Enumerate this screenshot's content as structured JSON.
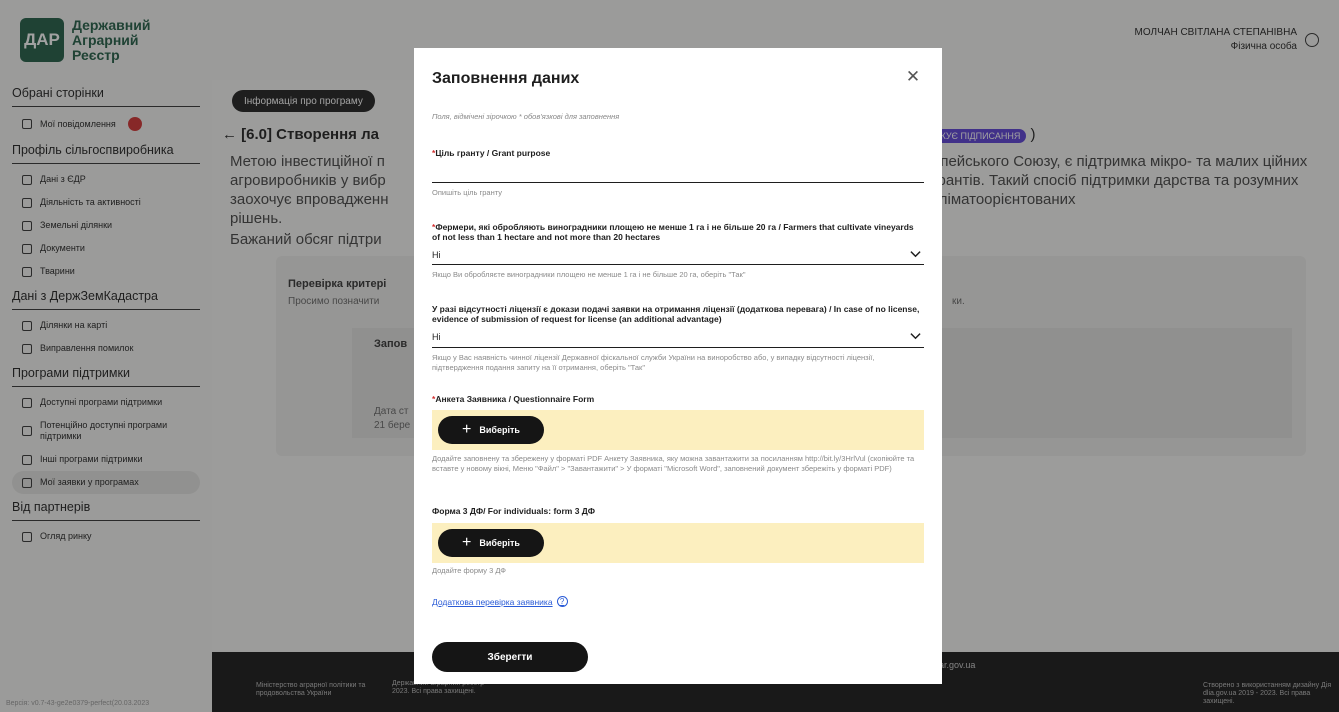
{
  "app": {
    "logo_mark": "ДАР",
    "logo_line1": "Державний",
    "logo_line2": "Аграрний",
    "logo_line3": "Реєстр",
    "user_name": "МОЛЧАН СВІТЛАНА СТЕПАНІВНА",
    "user_role": "Фізична особа"
  },
  "sidebar": {
    "sec_fav": "Обрані сторінки",
    "messages": "Мої повідомлення",
    "sec_profile": "Профіль сільгоспвиробника",
    "edr": "Дані з ЄДР",
    "activity": "Діяльність та активності",
    "land": "Земельні ділянки",
    "docs": "Документи",
    "animals": "Тварини",
    "sec_dzk": "Дані з ДержЗемКадастра",
    "map": "Ділянки на карті",
    "fix": "Виправлення помилок",
    "sec_programs": "Програми підтримки",
    "available": "Доступні програми підтримки",
    "potential": "Потенційно доступні програми підтримки",
    "other": "Інші програми підтримки",
    "my_apps": "Мої заявки у програмах",
    "sec_partners": "Від партнерів",
    "market": "Огляд ринку"
  },
  "background": {
    "info_pill": "Інформація про програму",
    "page_title": "← [6.0] Створення ла",
    "sign_tag": "ІКУЄ ПІДПИСАННЯ",
    "desc_left": "Метою інвестиційної п агровиробників у вибр заохочує впровадженн рішень.",
    "desc_left2": "Бажаний обсяг підтри",
    "desc_right": "опейського Союзу, є підтримка мікро- та малих ційних грантів. Такий спосіб підтримки дарства та розумних кліматоорієнтованих",
    "check_title": "Перевірка критері",
    "check_sub": "Просимо позначити",
    "fill_title": "Запов",
    "date_label": "Дата ст",
    "date_val": "21 бере",
    "right_tail": "ки."
  },
  "footer": {
    "ministry": "Міністерство аграрної політики та продовольства України",
    "registry": "Державний аграрний реєстр 2023. Всі права захищені.",
    "site": "dar.gov.ua",
    "diia": "Створено з використанням дизайну Дія dlia.gov.ua 2019 - 2023. Всі права захищені.",
    "version": "Версія: v0.7-43-ge2e0379-perfect(20.03.2023"
  },
  "modal": {
    "title": "Заповнення даних",
    "note": "Поля, відмічені зірочкою * обов'язкові для заповнення",
    "f1_label": "Ціль гранту / Grant purpose",
    "f1_placeholder": "Опишіть ціль гранту",
    "f2_label": "Фермери, які обробляють виноградники площею не менше 1 га і не більше 20 га / Farmers that cultivate vineyards of not less than 1 hectare and not more than 20 hectares",
    "f2_value": "Ні",
    "f2_help": "Якщо Ви обробляєте виноградники площею не менше 1 га і не більше 20 га, оберіть \"Так\"",
    "f3_label": "У разі відсутності ліцензії є докази подачі заявки на отримання ліцензії (додаткова перевага) / In case of no license, evidence of submission of request for license (an additional advantage)",
    "f3_value": "Ні",
    "f3_help": "Якщо у Вас наявність чинної ліцензії Державної фіскальної служби України на виноробство або, у випадку відсутності ліцензії, підтвердження подання запиту на її отримання, оберіть \"Так\"",
    "f4_label": "Анкета Заявника / Questionnaire Form",
    "f4_button": "Виберіть",
    "f4_help": "Додайте заповнену та збережену у форматі PDF Анкету Заявника, яку можна завантажити за посиланням http://bit.ly/3HrlVul (скопіюйте та вставте у новому вікні, Меню \"Файл\" > \"Завантажити\" > У форматі \"Microsoft Word\", заповнений документ збережіть у форматі PDF)",
    "f5_label": "Форма 3 ДФ/ For individuals: form 3 ДФ",
    "f5_button": "Виберіть",
    "f5_help": "Додайте форму 3 ДФ",
    "extra_link": "Додаткова перевірка заявника",
    "save": "Зберегти"
  },
  "colors": {
    "brand_green": "#1f5c44",
    "upload_bg": "#fcefbf",
    "required_red": "#d32f2f",
    "link_blue": "#2a5bd7",
    "sign_violet": "#5b3fd6"
  },
  "icons": {
    "close": "close-icon",
    "chevron": "chevron-down-icon",
    "plus": "plus-icon",
    "help": "question-icon",
    "user": "user-icon"
  }
}
